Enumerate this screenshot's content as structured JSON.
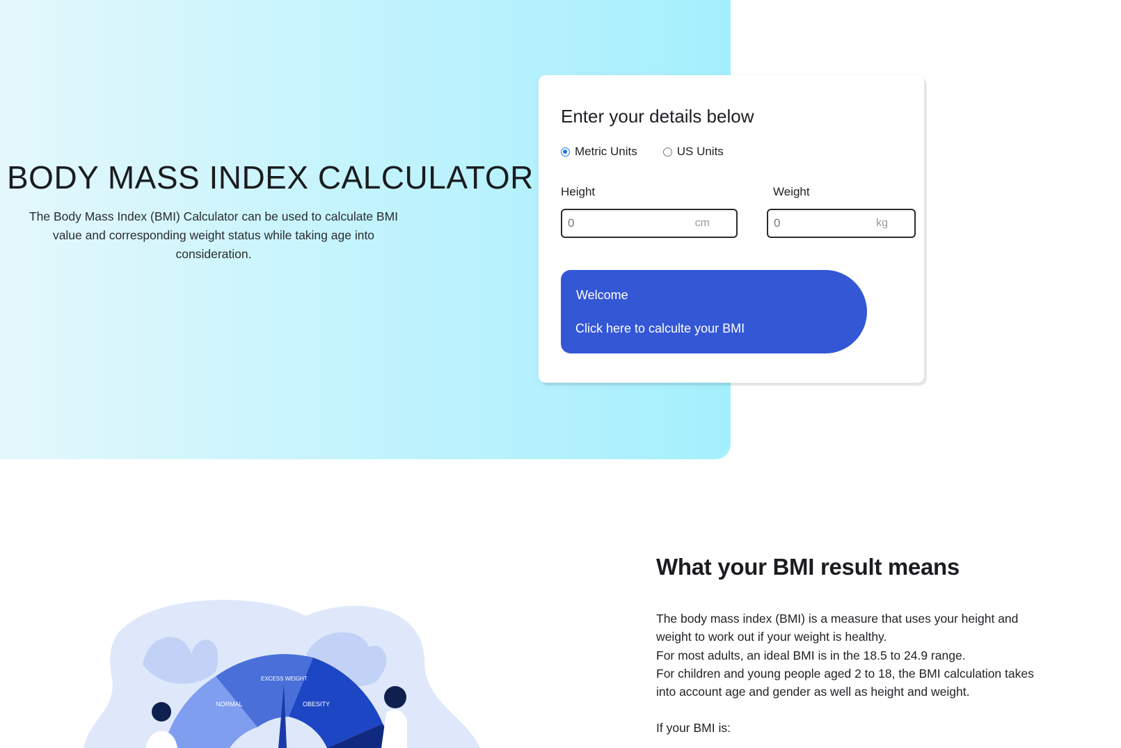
{
  "hero": {
    "title": "BODY MASS INDEX CALCULATOR",
    "subtitle": "The Body Mass Index (BMI) Calculator can be used to calculate BMI value and corresponding weight status while taking age into consideration."
  },
  "form": {
    "title": "Enter your details below",
    "units": [
      {
        "label": "Metric Units",
        "selected": true
      },
      {
        "label": "US Units",
        "selected": false
      }
    ],
    "height": {
      "label": "Height",
      "value": "0",
      "unit": "cm"
    },
    "weight": {
      "label": "Weight",
      "value": "0",
      "unit": "kg"
    },
    "cta": {
      "welcome": "Welcome",
      "action": "Click here to calculte your BMI"
    }
  },
  "info": {
    "title": "What your BMI result means",
    "lines": [
      "The body mass index (BMI) is a measure that uses your height and weight to work out if your weight is healthy.",
      "For most adults, an ideal BMI is in the 18.5 to 24.9 range.",
      "For children and young people aged 2 to 18, the BMI calculation takes",
      "into account age and gender as well as height and weight.",
      "If your BMI is:"
    ]
  },
  "gauge": {
    "labels": [
      "NORMAL",
      "EXCESS WEIGHT",
      "OBESITY"
    ]
  },
  "colors": {
    "accent": "#3457d5",
    "radio": "#1a73e8"
  }
}
